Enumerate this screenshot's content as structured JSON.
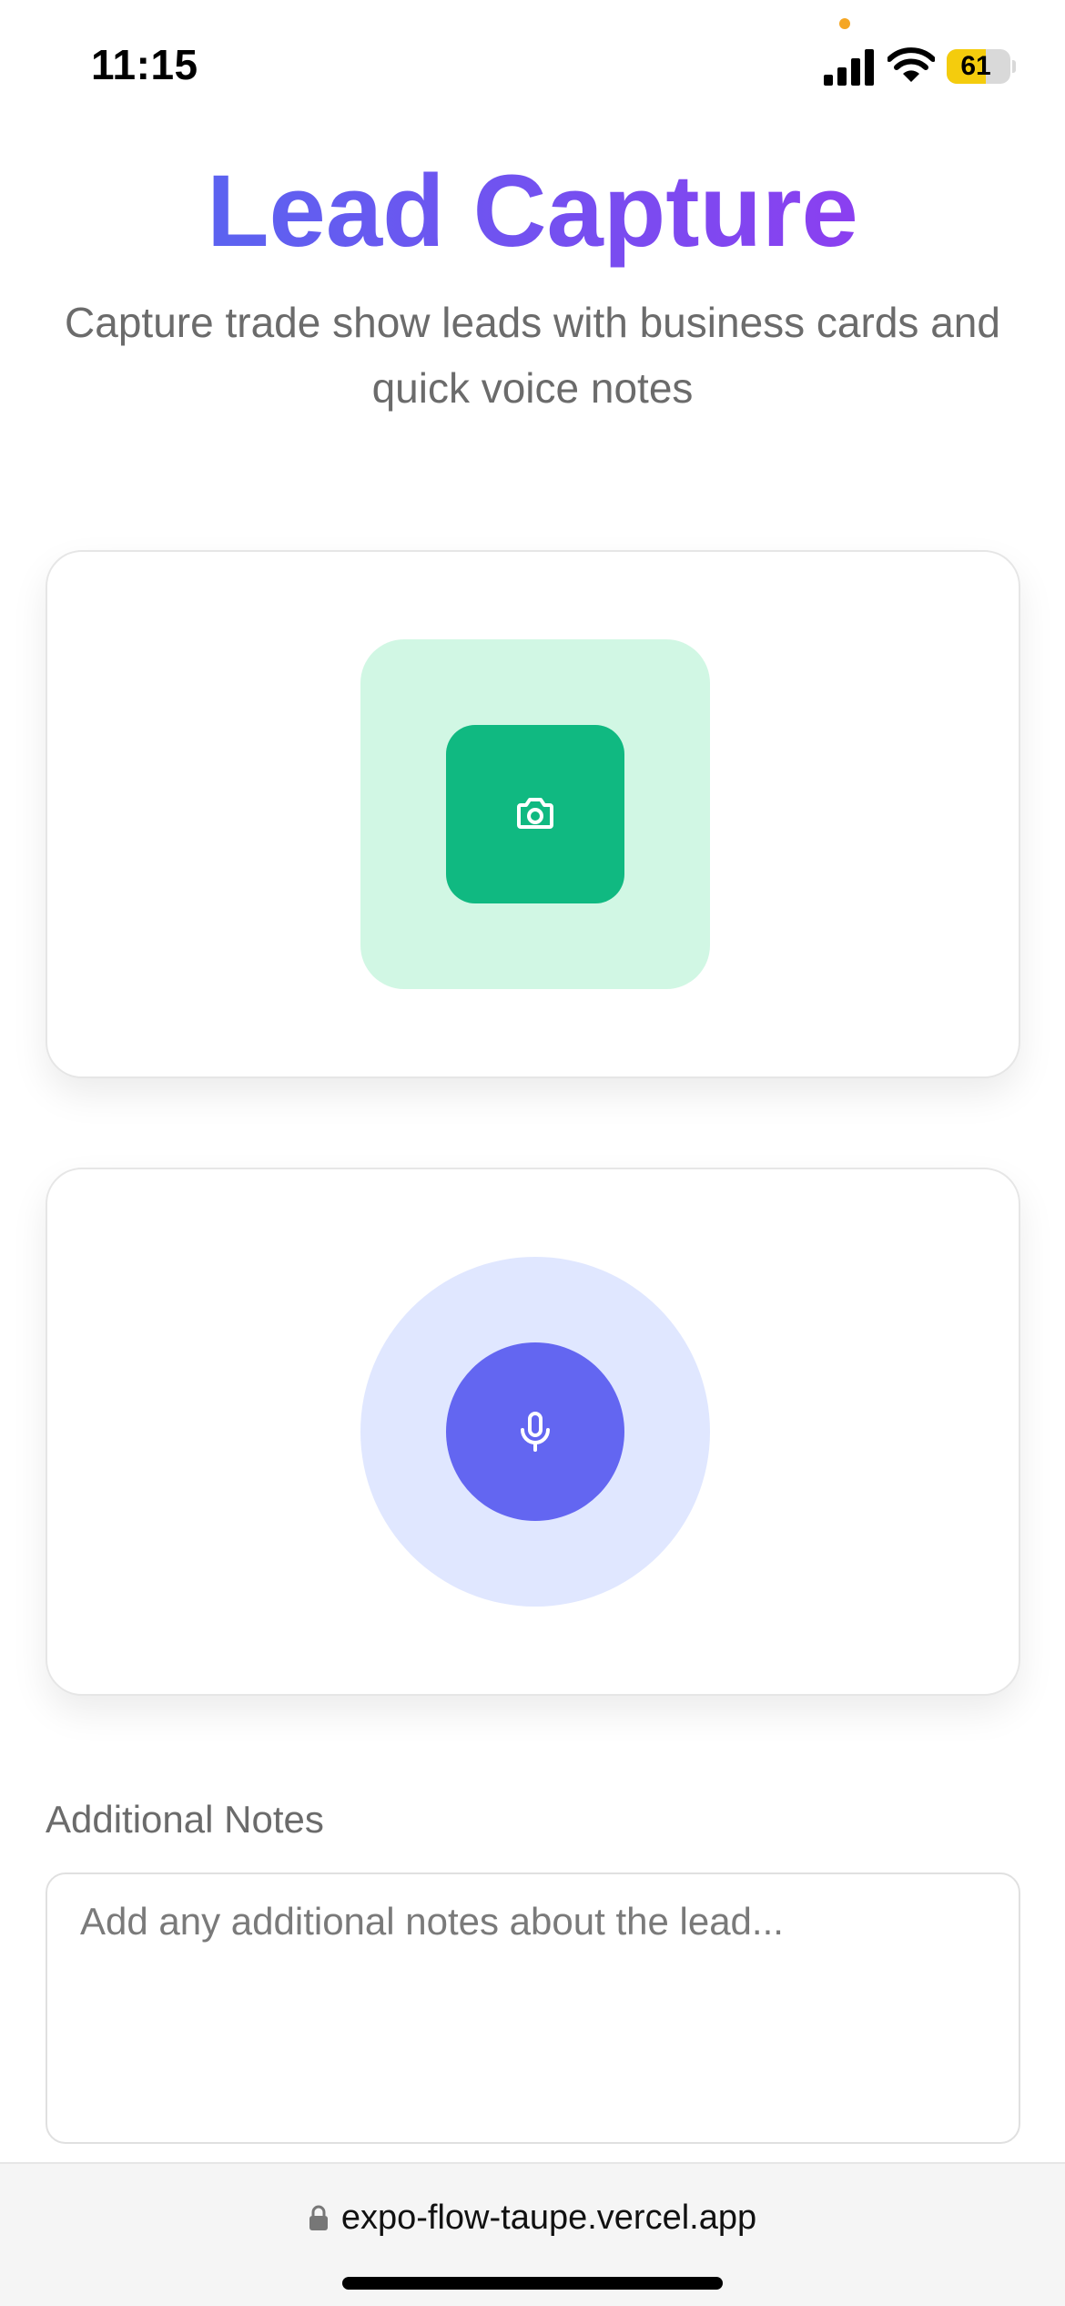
{
  "status_bar": {
    "time": "11:15",
    "battery_level": "61",
    "battery_fraction": 0.61,
    "icons": [
      "cellular-signal-icon",
      "wifi-icon",
      "battery-icon"
    ]
  },
  "header": {
    "title": "Lead Capture",
    "subtitle": "Capture trade show leads with business cards and quick voice notes"
  },
  "capture": {
    "camera_icon": "camera-icon",
    "mic_icon": "microphone-icon"
  },
  "notes": {
    "label": "Additional Notes",
    "placeholder": "Add any additional notes about the lead...",
    "value": ""
  },
  "browser": {
    "url": "expo-flow-taupe.vercel.app",
    "lock_icon": "lock-icon"
  },
  "colors": {
    "title_gradient_start": "#5b63f0",
    "title_gradient_end": "#8b3ff0",
    "camera_accent": "#10b981",
    "camera_halo": "#d1f7e4",
    "mic_accent": "#6366f1",
    "mic_halo": "#e0e7ff",
    "battery_fill": "#f4cc0d"
  }
}
